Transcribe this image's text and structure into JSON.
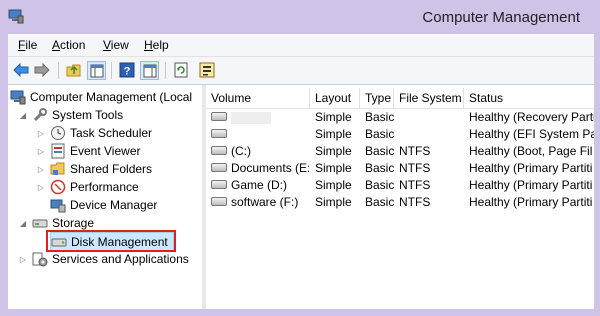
{
  "window": {
    "title": "Computer Management"
  },
  "menu": {
    "file": "File",
    "action": "Action",
    "view": "View",
    "help": "Help"
  },
  "tree": {
    "root": "Computer Management (Local",
    "system_tools": "System Tools",
    "task_scheduler": "Task Scheduler",
    "event_viewer": "Event Viewer",
    "shared_folders": "Shared Folders",
    "performance": "Performance",
    "device_manager": "Device Manager",
    "storage": "Storage",
    "disk_management": "Disk Management",
    "services": "Services and Applications"
  },
  "table": {
    "headers": {
      "volume": "Volume",
      "layout": "Layout",
      "type": "Type",
      "filesystem": "File System",
      "status": "Status"
    },
    "rows": [
      {
        "volume": "",
        "layout": "Simple",
        "type": "Basic",
        "filesystem": "",
        "status": "Healthy (Recovery Parti"
      },
      {
        "volume": "",
        "layout": "Simple",
        "type": "Basic",
        "filesystem": "",
        "status": "Healthy (EFI System Pa"
      },
      {
        "volume": "(C:)",
        "layout": "Simple",
        "type": "Basic",
        "filesystem": "NTFS",
        "status": "Healthy (Boot, Page Fil"
      },
      {
        "volume": "Documents (E:)",
        "layout": "Simple",
        "type": "Basic",
        "filesystem": "NTFS",
        "status": "Healthy (Primary Partiti"
      },
      {
        "volume": "Game (D:)",
        "layout": "Simple",
        "type": "Basic",
        "filesystem": "NTFS",
        "status": "Healthy (Primary Partiti"
      },
      {
        "volume": "software (F:)",
        "layout": "Simple",
        "type": "Basic",
        "filesystem": "NTFS",
        "status": "Healthy (Primary Partiti"
      }
    ]
  },
  "colors": {
    "frame": "#cfc4e8",
    "highlight": "#cce8ff",
    "annotation": "#e02020"
  }
}
